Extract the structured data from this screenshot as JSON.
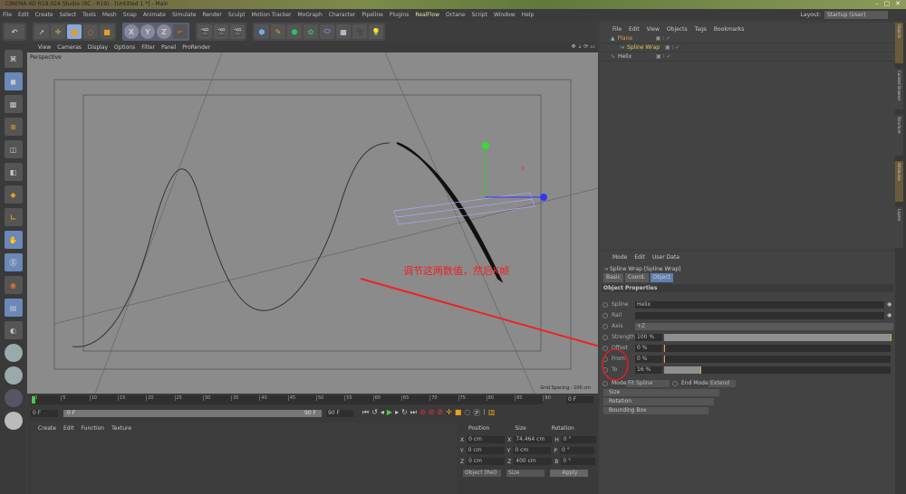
{
  "window": {
    "title": "CINEMA 4D R19.024 Studio (RC - R19) - [Untitled 1 *] - Main",
    "controls": [
      "–",
      "▢",
      "✕"
    ]
  },
  "menu": [
    "File",
    "Edit",
    "Create",
    "Select",
    "Tools",
    "Mesh",
    "Snap",
    "Animate",
    "Simulate",
    "Render",
    "Sculpt",
    "Motion Tracker",
    "MoGraph",
    "Character",
    "Pipeline",
    "Plugins",
    "RealFlow",
    "Octane",
    "Script",
    "Window",
    "Help"
  ],
  "layout": {
    "label": "Layout:",
    "value": "Startup (User)"
  },
  "toolbar": {
    "axis": [
      "X",
      "Y",
      "Z"
    ]
  },
  "viewport": {
    "menu": [
      "View",
      "Cameras",
      "Display",
      "Options",
      "Filter",
      "Panel",
      "ProRender"
    ],
    "label": "Perspective",
    "grid_spacing": "Grid Spacing : 100 cm",
    "annotation": "调节这两数值，然后K帧",
    "annotation_color": "#ff2a2a"
  },
  "timeline": {
    "ticks": [
      "0",
      "5",
      "10",
      "15",
      "20",
      "25",
      "30",
      "35",
      "40",
      "45",
      "50",
      "55",
      "60",
      "65",
      "70",
      "75",
      "80",
      "85",
      "90"
    ],
    "end_field": "0 F",
    "start": "0 F",
    "range_start": "0 F",
    "range_end": "90 F",
    "max": "90 F"
  },
  "material_manager": {
    "menu": [
      "Create",
      "Edit",
      "Function",
      "Texture"
    ]
  },
  "coordinates": {
    "headers": [
      "Position",
      "Size",
      "Rotation"
    ],
    "rows": [
      {
        "axis": "X",
        "pos": "0 cm",
        "saxis": "X",
        "size": "74.464 cm",
        "raxis": "H",
        "rot": "0 °"
      },
      {
        "axis": "Y",
        "pos": "0 cm",
        "saxis": "Y",
        "size": "0 cm",
        "raxis": "P",
        "rot": "0 °"
      },
      {
        "axis": "Z",
        "pos": "0 cm",
        "saxis": "Z",
        "size": "400 cm",
        "raxis": "B",
        "rot": "0 °"
      }
    ],
    "mode": "Object (Rel)",
    "size_mode": "Size",
    "apply": "Apply"
  },
  "object_manager": {
    "menu": [
      "File",
      "Edit",
      "View",
      "Objects",
      "Tags",
      "Bookmarks"
    ],
    "objects": [
      {
        "name": "Plane",
        "color": "#d9a04a"
      },
      {
        "name": "Spline Wrap",
        "color": "#e0d060"
      },
      {
        "name": "Helix",
        "color": "#c8c8c8"
      }
    ]
  },
  "attribute_manager": {
    "menu": [
      "Mode",
      "Edit",
      "User Data"
    ],
    "object_title": "Spline Wrap [Spline Wrap]",
    "tabs": [
      "Basic",
      "Coord.",
      "Object"
    ],
    "active_tab": "Object",
    "section": "Object Properties",
    "spline": {
      "label": "Spline",
      "value": "Helix"
    },
    "rail": {
      "label": "Rail",
      "value": ""
    },
    "axis": {
      "label": "Axis",
      "value": "+Z"
    },
    "strength": {
      "label": "Strength",
      "value": "100 %",
      "fraction": 1.0
    },
    "offset": {
      "label": "Offset",
      "value": "0 %",
      "fraction": 0
    },
    "from": {
      "label": "From",
      "value": "0 %",
      "fraction": 0
    },
    "to": {
      "label": "To",
      "value": "16 %",
      "fraction": 0.16
    },
    "mode": {
      "label": "Mode",
      "value": "Fit Spline"
    },
    "end_mode": {
      "label": "End Mode",
      "value": "Extend"
    },
    "groups": [
      "Size",
      "Rotation",
      "Bounding Box"
    ]
  },
  "right_tabs": [
    "Objects",
    "Content Browser",
    "Structure",
    "Attributes",
    "Layers"
  ]
}
